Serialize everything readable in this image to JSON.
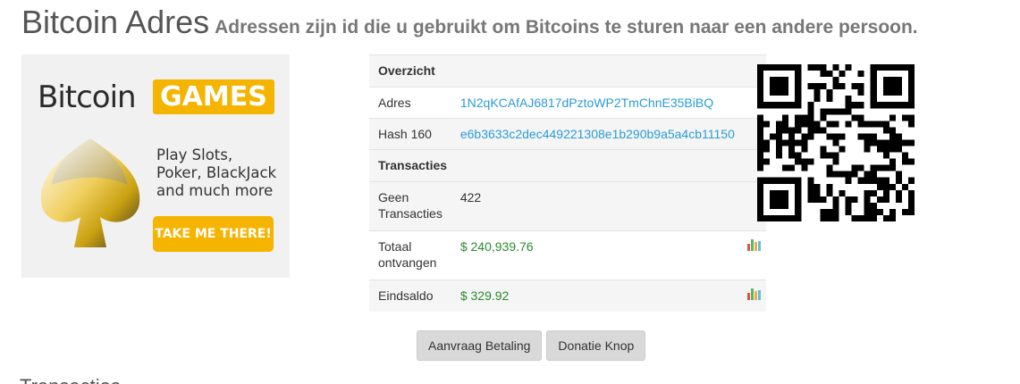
{
  "header": {
    "title": "Bitcoin Adres",
    "subtitle": "Adressen zijn id die u gebruikt om Bitcoins te sturen naar een andere persoon."
  },
  "ad": {
    "brand": "Bitcoin",
    "games": "GAMES",
    "tagline": "Play Slots, Poker, BlackJack and much more",
    "cta": "TAKE ME THERE!",
    "accent_color": "#f5b400"
  },
  "table": {
    "overview_header": "Overzicht",
    "address_label": "Adres",
    "address_value": "1N2qKCAfAJ6817dPztoWP2TmChnE35BiBQ",
    "hash_label": "Hash 160",
    "hash_value": "e6b3633c2dec449221308e1b290b9a5a4cb11150",
    "transactions_header": "Transacties",
    "tx_count_label": "Geen Transacties",
    "tx_count_value": "422",
    "received_label": "Totaal ontvangen",
    "received_value": "$ 240,939.76",
    "balance_label": "Eindsaldo",
    "balance_value": "$ 329.92",
    "link_color": "#2a9bd6",
    "value_color": "#2a8a2a"
  },
  "icons": {
    "chart": "bar-chart-icon",
    "qr": "qr-code"
  },
  "buttons": {
    "request_payment": "Aanvraag Betaling",
    "donation_button": "Donatie Knop"
  },
  "section": {
    "title": "Transacties"
  }
}
